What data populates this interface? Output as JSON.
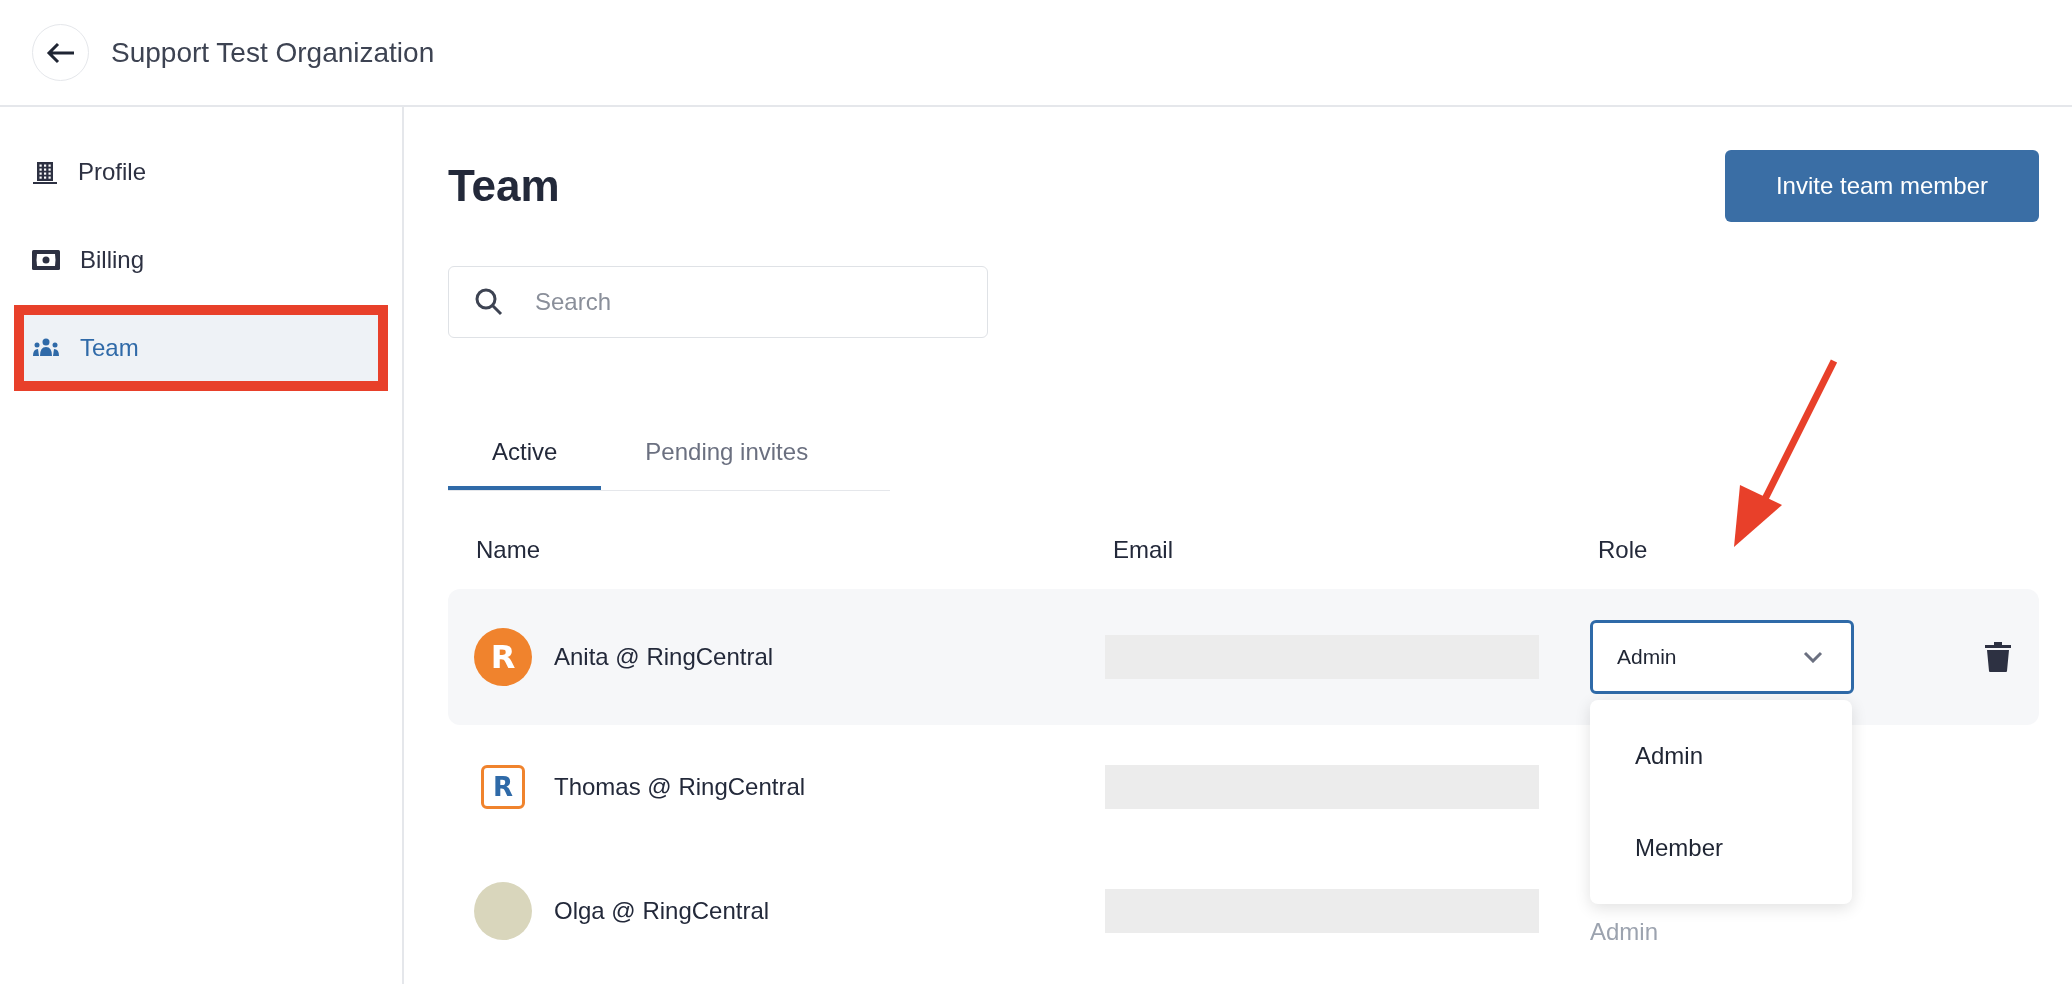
{
  "header": {
    "title": "Support Test Organization"
  },
  "sidebar": {
    "items": [
      {
        "label": "Profile",
        "kind": "building",
        "selected": false
      },
      {
        "label": "Billing",
        "kind": "money",
        "selected": false
      },
      {
        "label": "Team",
        "kind": "people",
        "selected": true
      }
    ]
  },
  "page": {
    "title": "Team",
    "invite_button": "Invite team member",
    "search": {
      "placeholder": "Search"
    }
  },
  "tabs": [
    {
      "label": "Active",
      "selected": true
    },
    {
      "label": "Pending invites",
      "selected": false
    }
  ],
  "table": {
    "columns": [
      "Name",
      "Email",
      "Role"
    ],
    "rows": [
      {
        "name": "Anita @ RingCentral",
        "avatar": {
          "kind": "logo-round",
          "letter": "R"
        },
        "highlighted": true,
        "role": {
          "kind": "select",
          "value": "Admin",
          "open": true,
          "options": [
            "Admin",
            "Member"
          ]
        }
      },
      {
        "name": "Thomas @ RingCentral",
        "avatar": {
          "kind": "logo-square",
          "letter": "R"
        },
        "highlighted": false
      },
      {
        "name": "Olga @ RingCentral",
        "avatar": {
          "kind": "photo"
        },
        "highlighted": false,
        "role": {
          "kind": "text",
          "value": "Admin"
        }
      }
    ]
  }
}
